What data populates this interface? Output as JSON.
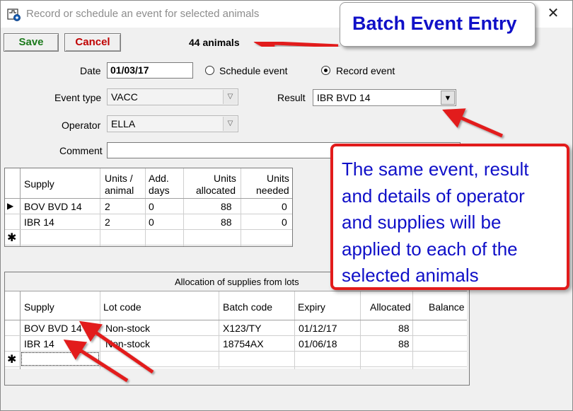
{
  "window": {
    "title": "Record or schedule an event for selected animals",
    "close_glyph": "✕"
  },
  "toolbar": {
    "save_label": "Save",
    "cancel_label": "Cancel",
    "animals_count": "44 animals"
  },
  "form": {
    "date_label": "Date",
    "date_value": "01/03/17",
    "schedule_label": "Schedule event",
    "record_label": "Record event",
    "selected_mode": "Record event",
    "event_type_label": "Event type",
    "event_type_value": "VACC",
    "result_label": "Result",
    "result_value": "IBR BVD 14",
    "operator_label": "Operator",
    "operator_value": "ELLA",
    "comment_label": "Comment",
    "comment_value": ""
  },
  "supplies_grid": {
    "headers": {
      "supply": "Supply",
      "units_animal_1": "Units /",
      "units_animal_2": "animal",
      "add_days_1": "Add.",
      "add_days_2": "days",
      "units_allocated_1": "Units",
      "units_allocated_2": "allocated",
      "units_needed_1": "Units",
      "units_needed_2": "needed"
    },
    "rows": [
      {
        "supply": "BOV BVD 14",
        "units_animal": "2",
        "add_days": "0",
        "units_allocated": "88",
        "units_needed": "0"
      },
      {
        "supply": "IBR 14",
        "units_animal": "2",
        "add_days": "0",
        "units_allocated": "88",
        "units_needed": "0"
      }
    ]
  },
  "lots_grid": {
    "caption": "Allocation of supplies from lots",
    "headers": {
      "supply": "Supply",
      "lot_code": "Lot code",
      "batch_code": "Batch code",
      "expiry": "Expiry",
      "allocated": "Allocated",
      "balance": "Balance"
    },
    "rows": [
      {
        "supply": "BOV BVD 14",
        "lot_code": "Non-stock",
        "batch_code": "X123/TY",
        "expiry": "01/12/17",
        "allocated": "88",
        "balance": ""
      },
      {
        "supply": "IBR 14",
        "lot_code": "Non-stock",
        "batch_code": "18754AX",
        "expiry": "01/06/18",
        "allocated": "88",
        "balance": ""
      }
    ]
  },
  "annotations": {
    "title_callout": "Batch Event Entry",
    "body_callout": "The same event, result and details of operator and supplies will be applied to each of the selected animals",
    "callout_text_color": "#1010c8",
    "callout_border_color": "#e21b1b",
    "arrow_color": "#e21b1b"
  },
  "colors": {
    "save_text": "#1c7a1c",
    "cancel_text": "#c00000"
  }
}
